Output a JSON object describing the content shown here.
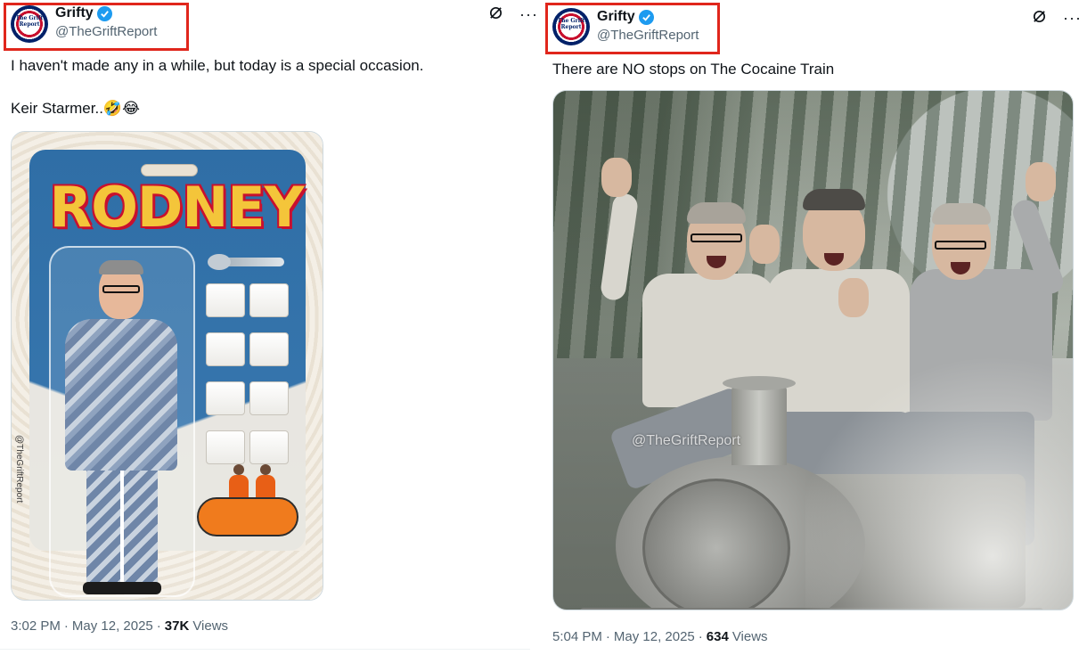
{
  "tweets": [
    {
      "display_name": "Grifty",
      "handle": "@TheGriftReport",
      "avatar_text": "The Grift Report",
      "text": "I haven't made any in a while, but today is a special occasion.\n\nKeir Starmer..🤣😂",
      "image": {
        "package_title": "RODNEY",
        "watermark": "@TheGriftReport"
      },
      "time": "3:02 PM",
      "date": "May 12, 2025",
      "views_count": "37K",
      "views_label": "Views"
    },
    {
      "display_name": "Grifty",
      "handle": "@TheGriftReport",
      "avatar_text": "The Grift Report",
      "text": "There are NO stops on The Cocaine Train",
      "image": {
        "watermark": "@TheGriftReport"
      },
      "time": "5:04 PM",
      "date": "May 12, 2025",
      "views_count": "634",
      "views_label": "Views"
    }
  ],
  "icons": {
    "verified": "verified-badge-icon",
    "grok": "grok-icon",
    "more": "more-icon"
  },
  "colors": {
    "highlight": "#e0261c",
    "verified": "#1d9bf0",
    "secondary_text": "#536471"
  }
}
